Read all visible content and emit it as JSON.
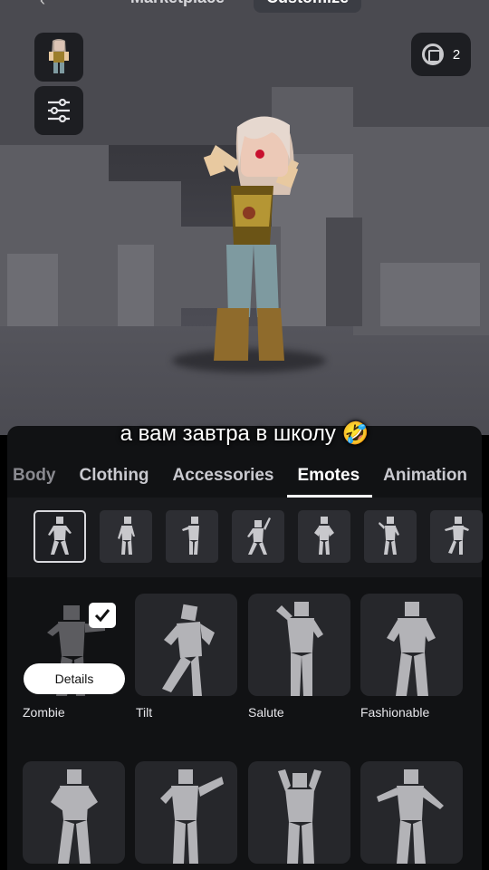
{
  "top_tabs": [
    {
      "label": "Marketplace",
      "active": false
    },
    {
      "label": "Customize",
      "active": true
    }
  ],
  "robux": {
    "icon": "robux-icon",
    "count": "2"
  },
  "caption": "а вам завтра в школу 🤣",
  "categories": [
    {
      "label": "Body",
      "active": false
    },
    {
      "label": "Clothing",
      "active": false
    },
    {
      "label": "Accessories",
      "active": false
    },
    {
      "label": "Emotes",
      "active": true
    },
    {
      "label": "Animation",
      "active": false
    }
  ],
  "emotes": [
    {
      "label": "Zombie",
      "equipped": true,
      "details_label": "Details"
    },
    {
      "label": "Tilt"
    },
    {
      "label": "Salute"
    },
    {
      "label": "Fashionable"
    },
    {
      "label": ""
    },
    {
      "label": ""
    },
    {
      "label": ""
    },
    {
      "label": ""
    }
  ],
  "colors": {
    "panel": "#111214",
    "strip": "#191a1d",
    "tile": "#26272b",
    "accent": "#ffffff"
  }
}
